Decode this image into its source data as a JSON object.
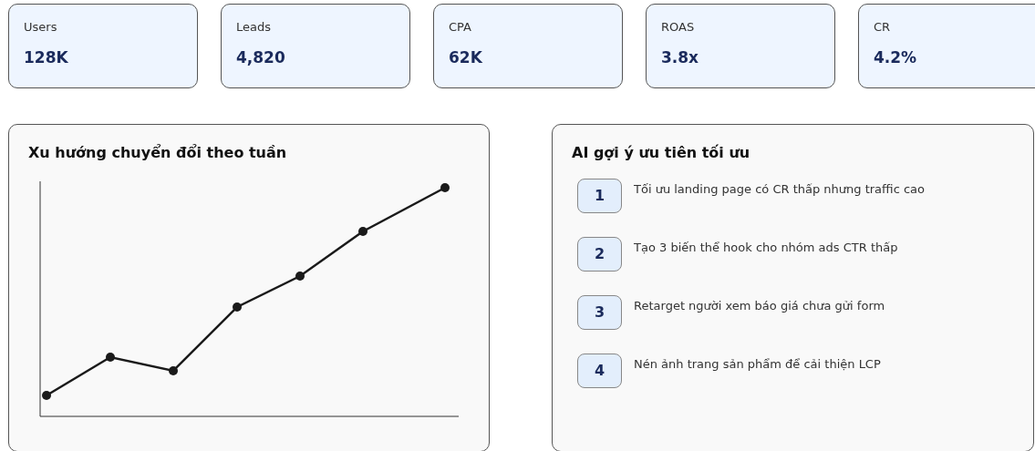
{
  "kpis": [
    {
      "label": "Users",
      "value": "128K"
    },
    {
      "label": "Leads",
      "value": "4,820"
    },
    {
      "label": "CPA",
      "value": "62K"
    },
    {
      "label": "ROAS",
      "value": "3.8x"
    },
    {
      "label": "CR",
      "value": "4.2%"
    }
  ],
  "trend": {
    "title": "Xu hướng chuyển đổi theo tuần"
  },
  "suggestions": {
    "title": "AI gợi ý ưu tiên tối ưu",
    "items": [
      {
        "rank": "1",
        "text": "Tối ưu landing page có CR thấp nhưng traffic cao"
      },
      {
        "rank": "2",
        "text": "Tạo 3 biến thể hook cho nhóm ads CTR thấp"
      },
      {
        "rank": "3",
        "text": "Retarget người xem báo giá chưa gửi form"
      },
      {
        "rank": "4",
        "text": "Nén ảnh trang sản phẩm để cải thiện LCP"
      }
    ]
  }
}
